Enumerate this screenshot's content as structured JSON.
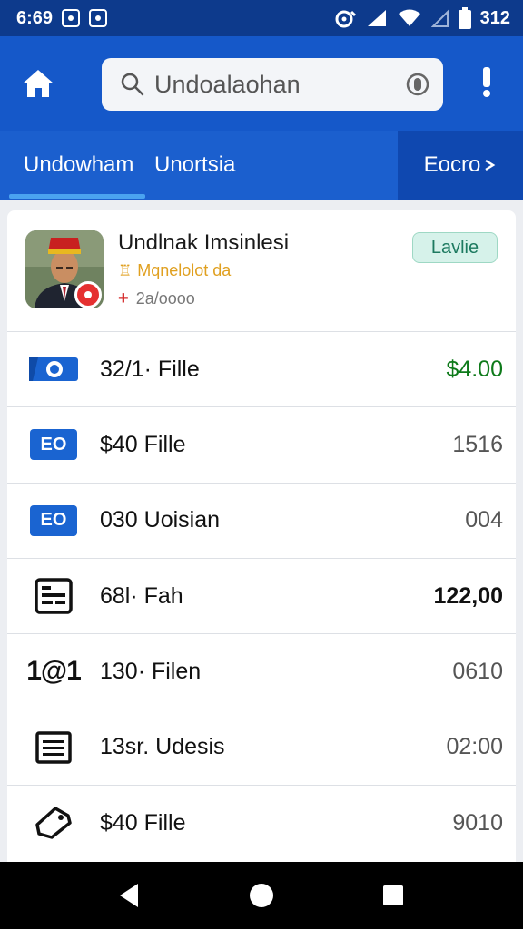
{
  "status_bar": {
    "time": "6:69",
    "battery": "312"
  },
  "header": {
    "search_placeholder": "Undoalaohan"
  },
  "tabs": {
    "tab1": "Undowham",
    "tab2": "Unortsia",
    "right": "Eocro"
  },
  "profile": {
    "name": "Undlnak Imsinlesi",
    "role": "Mqnelolot da",
    "meta": "2a/oooo",
    "badge": "Lavlie"
  },
  "rows": [
    {
      "icon": "camera-icon",
      "label": "32/1· Fille",
      "value": "$4.00"
    },
    {
      "icon": "eo-chip-icon",
      "chip": "EO",
      "label": "$40  Fille",
      "value": "1516"
    },
    {
      "icon": "eo-chip-icon",
      "chip": "EO",
      "label": "030  Uoisian",
      "value": "004"
    },
    {
      "icon": "document-icon",
      "label": "68l· Fah",
      "value": "122,00"
    },
    {
      "icon": "text-glyph-icon",
      "glyph": "1@1",
      "label": "130· Filen",
      "value": "0610"
    },
    {
      "icon": "list-icon",
      "label": "13sr. Udesis",
      "value": "02:00"
    },
    {
      "icon": "tag-icon",
      "label": "$40  Fille",
      "value": "9010"
    }
  ],
  "colors": {
    "status_bar": "#0d3a8c",
    "app_bar": "#1558c9",
    "accent_green": "#0e7a1a",
    "badge_bg": "#d6f2ea"
  }
}
